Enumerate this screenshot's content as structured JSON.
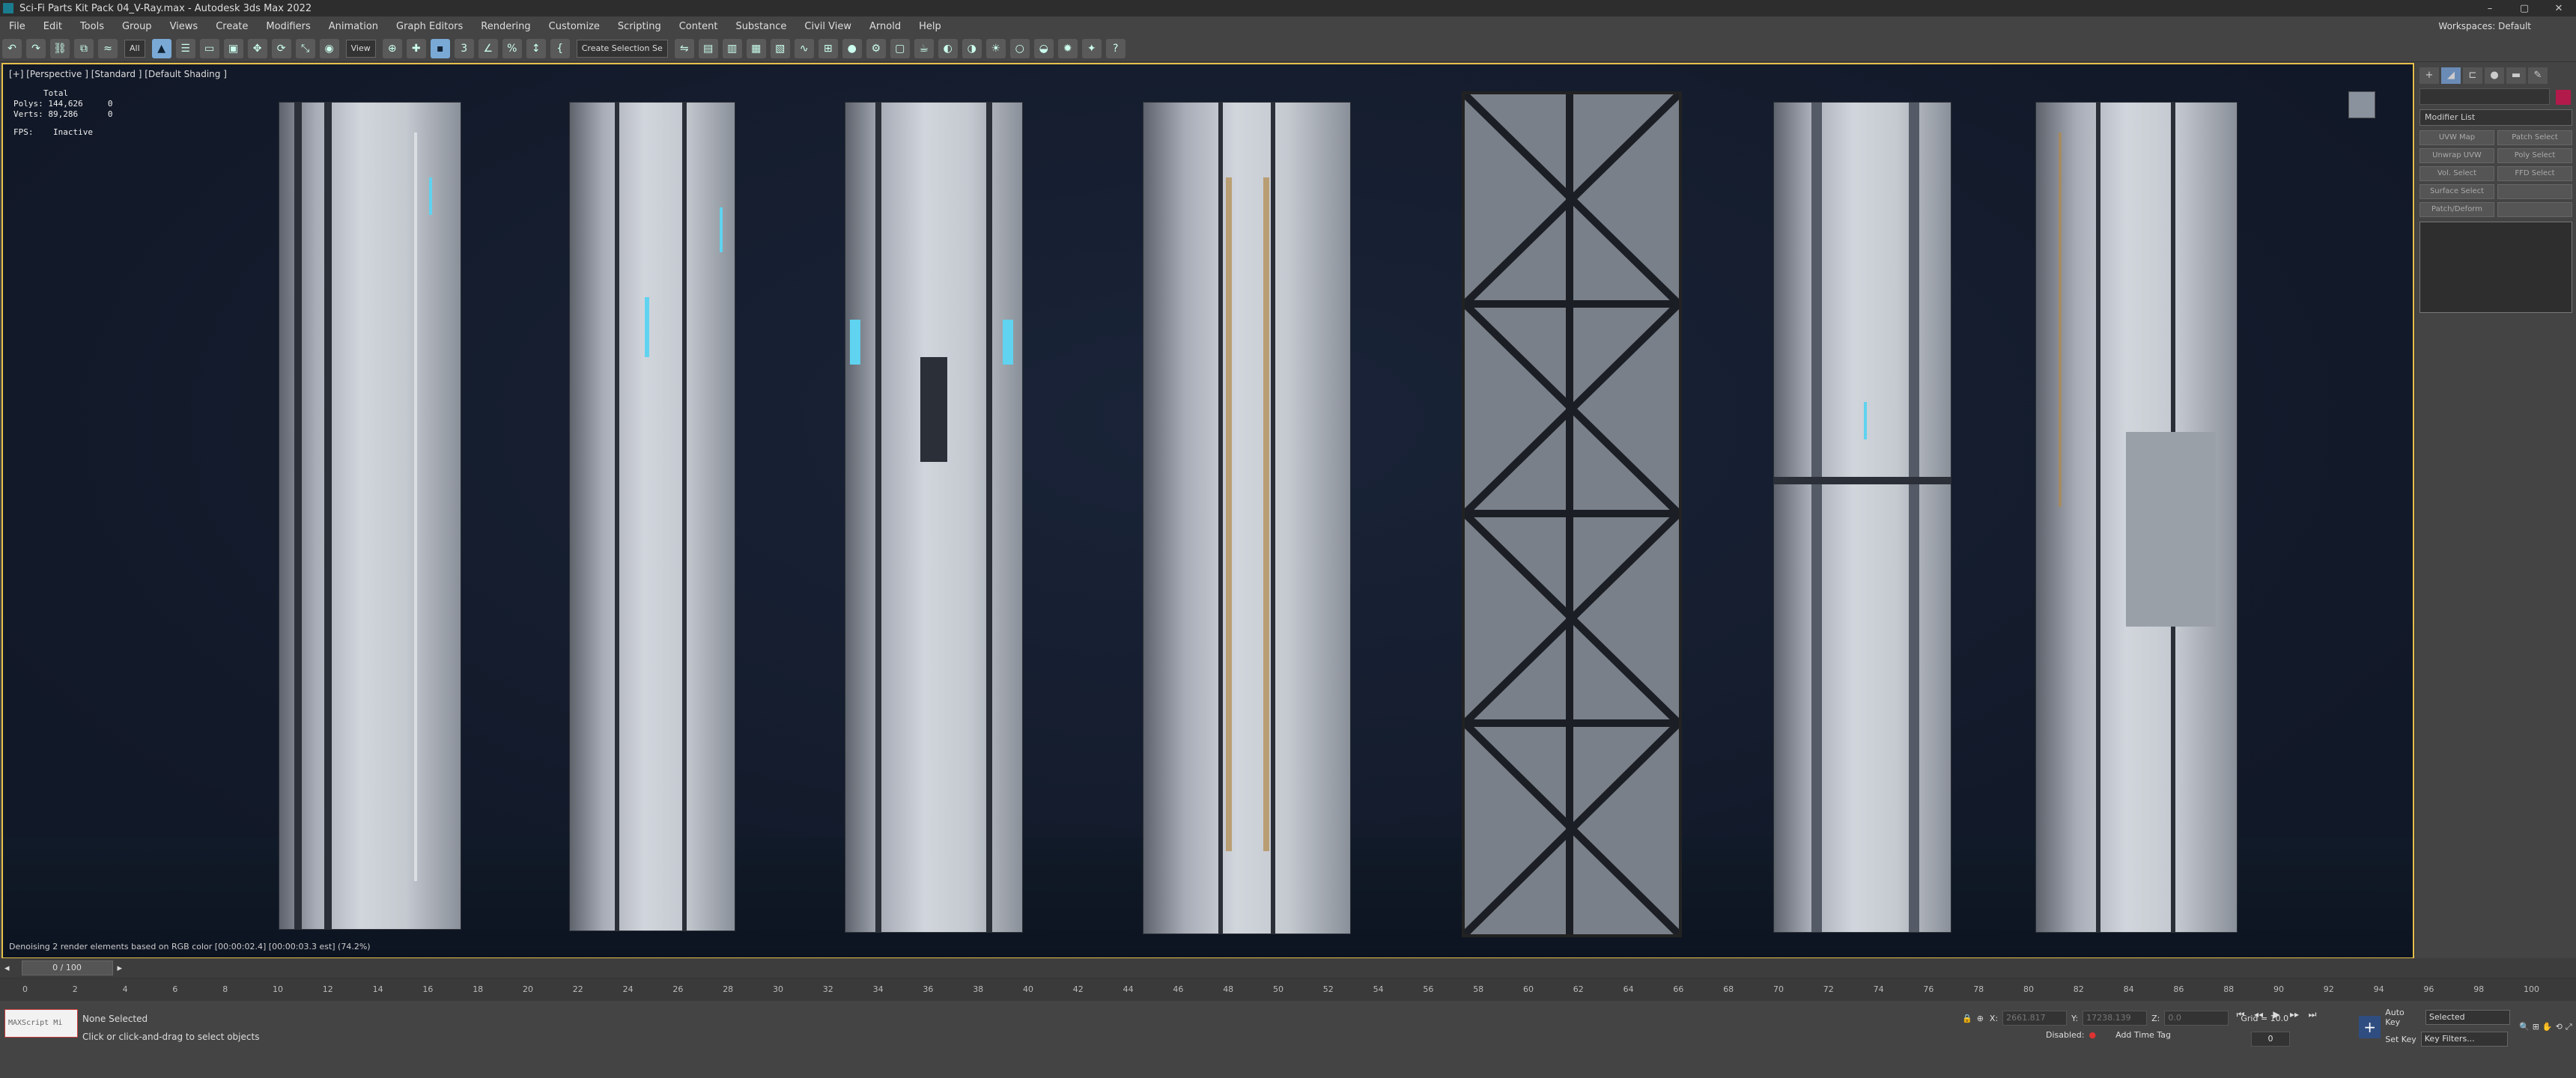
{
  "titlebar": {
    "title": "Sci-Fi Parts Kit Pack 04_V-Ray.max - Autodesk 3ds Max 2022",
    "workspace_label": "Workspaces:",
    "workspace_value": "Default"
  },
  "menu": {
    "items": [
      "File",
      "Edit",
      "Tools",
      "Group",
      "Views",
      "Create",
      "Modifiers",
      "Animation",
      "Graph Editors",
      "Rendering",
      "Customize",
      "Scripting",
      "Content",
      "Substance",
      "Civil View",
      "Arnold",
      "Help"
    ]
  },
  "toolbar": {
    "filter_dropdown": "All",
    "coord_dropdown": "View",
    "selection_set_label": "Create Selection Se"
  },
  "viewport": {
    "label": "[+] [Perspective ] [Standard ] [Default Shading ]",
    "stats": {
      "header": "Total",
      "polys_label": "Polys:",
      "polys_total": "144,626",
      "polys_sel": "0",
      "verts_label": "Verts:",
      "verts_total": "89,286",
      "verts_sel": "0",
      "fps_label": "FPS:",
      "fps_value": "Inactive"
    },
    "denoise_text": "Denoising 2 render elements based on RGB color [00:00:02.4] [00:00:03.3 est]   (74.2%)",
    "pillars": [
      "pillar-1",
      "pillar-2",
      "pillar-3",
      "pillar-4",
      "pillar-5-frame",
      "pillar-6",
      "pillar-7"
    ],
    "colors": {
      "background": "#111827",
      "border": "#e6c04a"
    }
  },
  "command_panel": {
    "modifier_list": "Modifier List",
    "buttons": [
      "UVW Map",
      "Patch Select",
      "Unwrap UVW",
      "Poly Select",
      "Vol. Select",
      "FFD Select",
      "Surface Select",
      "",
      "Patch/Deform",
      ""
    ]
  },
  "timeline": {
    "slider_label": "0 / 100",
    "ticks": [
      "0",
      "2",
      "4",
      "6",
      "8",
      "10",
      "12",
      "14",
      "16",
      "18",
      "20",
      "22",
      "24",
      "26",
      "28",
      "30",
      "32",
      "34",
      "36",
      "38",
      "40",
      "42",
      "44",
      "46",
      "48",
      "50",
      "52",
      "54",
      "56",
      "58",
      "60",
      "62",
      "64",
      "66",
      "68",
      "70",
      "72",
      "74",
      "76",
      "78",
      "80",
      "82",
      "84",
      "86",
      "88",
      "90",
      "92",
      "94",
      "96",
      "98",
      "100"
    ]
  },
  "status": {
    "maxscript_placeholder": "MAXScript Mi",
    "selection": "None Selected",
    "prompt": "Click or click-and-drag to select objects",
    "x_label": "X:",
    "x_value": "2661.817",
    "y_label": "Y:",
    "y_value": "17238.139",
    "z_label": "Z:",
    "z_value": "0.0",
    "grid": "Grid = 10.0",
    "disabled_label": "Disabled:",
    "add_time_tag": "Add Time Tag",
    "auto_key": "Auto Key",
    "set_key": "Set Key",
    "selected_dd": "Selected",
    "key_filters": "Key Filters...",
    "frame": "0"
  }
}
